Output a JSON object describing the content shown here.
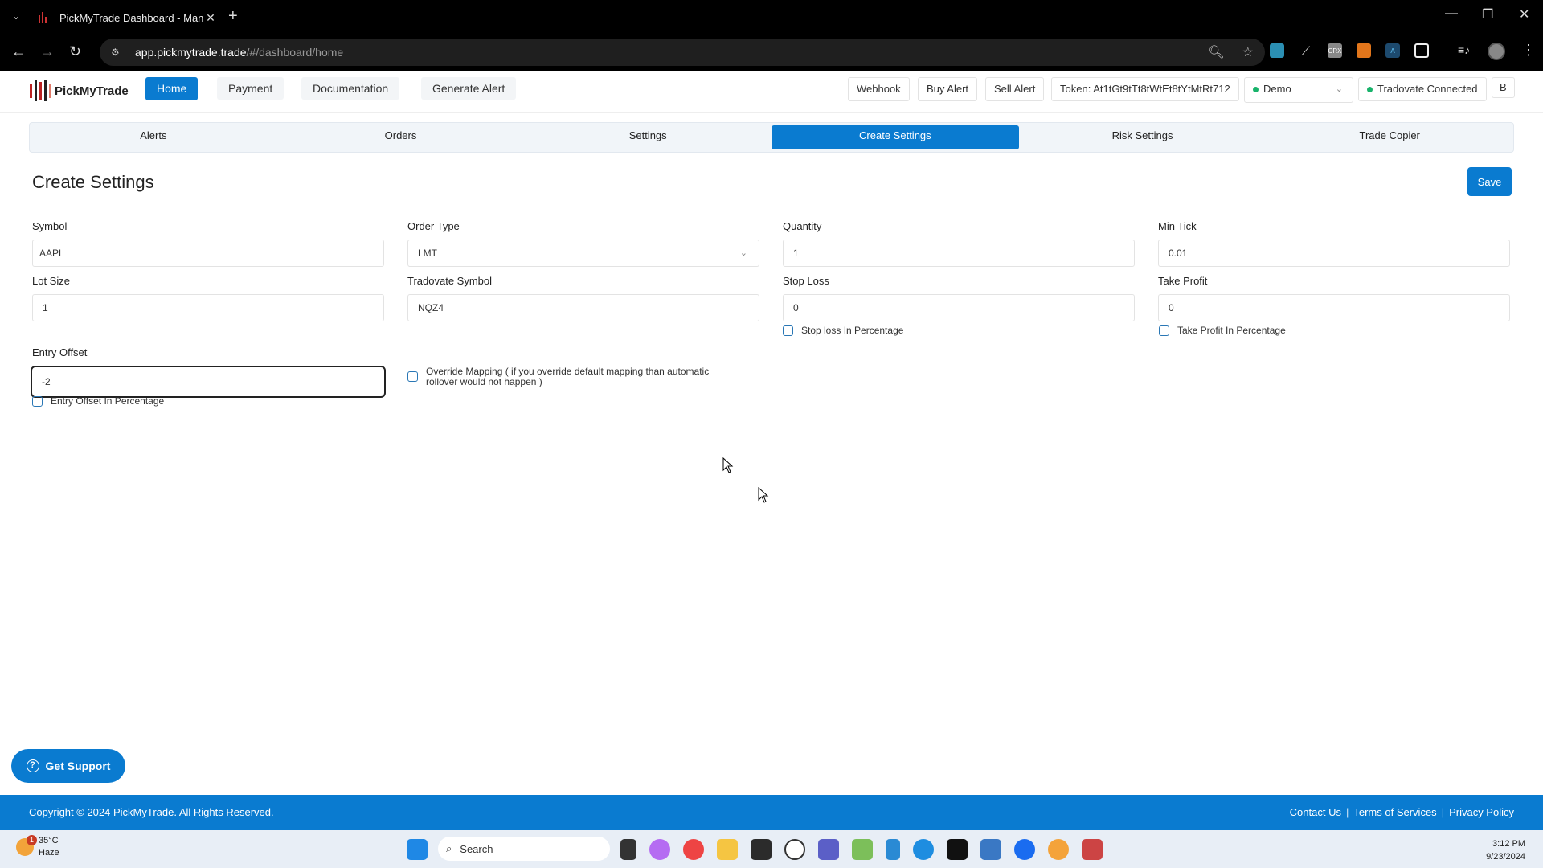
{
  "browser": {
    "tab_title": "PickMyTrade Dashboard - Mana",
    "url_host": "app.pickmytrade.trade",
    "url_path": "/#/dashboard/home",
    "extensions": [
      "spider-web-extension",
      "broom-extension",
      "crx-extension",
      "metamask-extension",
      "drafting-compass-extension",
      "puzzle-extensions"
    ]
  },
  "header": {
    "logo_text": "PickMyTrade",
    "nav": [
      {
        "label": "Home",
        "active": true
      },
      {
        "label": "Payment",
        "active": false
      },
      {
        "label": "Documentation",
        "active": false
      },
      {
        "label": "Generate Alert",
        "active": false
      }
    ],
    "webhook_label": "Webhook",
    "buy_alert_label": "Buy Alert",
    "sell_alert_label": "Sell Alert",
    "token_label": "Token: At1tGt9tTt8tWtEt8tYtMtRt712",
    "account_mode": "Demo",
    "connection_status": "Tradovate Connected",
    "user_initial": "B",
    "status_color": "#19b36b"
  },
  "subtabs": [
    {
      "label": "Alerts",
      "active": false
    },
    {
      "label": "Orders",
      "active": false
    },
    {
      "label": "Settings",
      "active": false
    },
    {
      "label": "Create Settings",
      "active": true
    },
    {
      "label": "Risk Settings",
      "active": false
    },
    {
      "label": "Trade Copier",
      "active": false
    }
  ],
  "page": {
    "title": "Create Settings",
    "save_label": "Save"
  },
  "form": {
    "symbol": {
      "label": "Symbol",
      "value": "AAPL"
    },
    "order_type": {
      "label": "Order Type",
      "value": "LMT"
    },
    "quantity": {
      "label": "Quantity",
      "value": "1"
    },
    "min_tick": {
      "label": "Min Tick",
      "value": "0.01"
    },
    "lot_size": {
      "label": "Lot Size",
      "value": "1"
    },
    "tradovate_symbol": {
      "label": "Tradovate Symbol",
      "value": "NQZ4"
    },
    "stop_loss": {
      "label": "Stop Loss",
      "value": "0"
    },
    "take_profit": {
      "label": "Take Profit",
      "value": "0"
    },
    "entry_offset": {
      "label": "Entry Offset",
      "value": "-2"
    },
    "stop_loss_pct": {
      "label": "Stop loss In Percentage",
      "checked": false
    },
    "take_profit_pct": {
      "label": "Take Profit In Percentage",
      "checked": false
    },
    "entry_offset_pct": {
      "label": "Entry Offset In Percentage",
      "checked": false
    },
    "override_mapping": {
      "label": "Override Mapping ( if you override default mapping than automatic rollover would not happen )",
      "checked": false
    }
  },
  "support_label": "Get Support",
  "footer": {
    "copyright": "Copyright © 2024 PickMyTrade. All Rights Reserved.",
    "links": [
      "Contact Us",
      "Terms of Services",
      "Privacy Policy"
    ]
  },
  "taskbar": {
    "temperature": "35°C",
    "weather": "Haze",
    "weather_badge": "1",
    "search_placeholder": "Search",
    "time": "3:12 PM",
    "date": "9/23/2024"
  },
  "brand_color": "#0a7bd0"
}
